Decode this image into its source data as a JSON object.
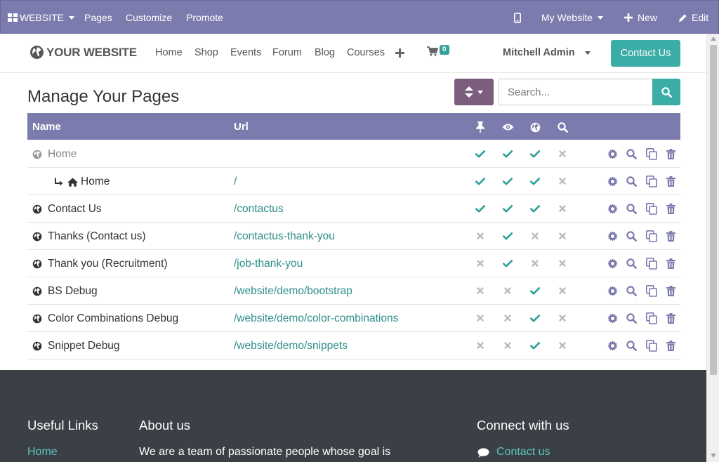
{
  "topbar": {
    "website_label": "WEBSITE",
    "pages_label": "Pages",
    "customize_label": "Customize",
    "promote_label": "Promote",
    "my_website_label": "My Website",
    "new_label": "New",
    "edit_label": "Edit"
  },
  "header": {
    "logo_text": "YOUR WEBSITE",
    "nav": [
      "Home",
      "Shop",
      "Events",
      "Forum",
      "Blog",
      "Courses"
    ],
    "cart_count": "0",
    "user_name": "Mitchell Admin",
    "contact_button": "Contact Us"
  },
  "main": {
    "title": "Manage Your Pages",
    "search_placeholder": "Search...",
    "columns": {
      "name": "Name",
      "url": "Url"
    },
    "rows": [
      {
        "name": "Home",
        "url": "",
        "dim": true,
        "icon": "globe",
        "indent": false,
        "pinned": true,
        "visible": true,
        "published": true,
        "indexed": false
      },
      {
        "name": "Home",
        "url": "/",
        "dim": false,
        "icon": "home",
        "indent": true,
        "pinned": true,
        "visible": true,
        "published": true,
        "indexed": false
      },
      {
        "name": "Contact Us",
        "url": "/contactus",
        "dim": false,
        "icon": "globe",
        "indent": false,
        "pinned": true,
        "visible": true,
        "published": true,
        "indexed": false
      },
      {
        "name": "Thanks (Contact us)",
        "url": "/contactus-thank-you",
        "dim": false,
        "icon": "globe",
        "indent": false,
        "pinned": false,
        "visible": true,
        "published": false,
        "indexed": false
      },
      {
        "name": "Thank you (Recruitment)",
        "url": "/job-thank-you",
        "dim": false,
        "icon": "globe",
        "indent": false,
        "pinned": false,
        "visible": true,
        "published": false,
        "indexed": false
      },
      {
        "name": "BS Debug",
        "url": "/website/demo/bootstrap",
        "dim": false,
        "icon": "globe",
        "indent": false,
        "pinned": false,
        "visible": false,
        "published": true,
        "indexed": false
      },
      {
        "name": "Color Combinations Debug",
        "url": "/website/demo/color-combinations",
        "dim": false,
        "icon": "globe",
        "indent": false,
        "pinned": false,
        "visible": false,
        "published": true,
        "indexed": false
      },
      {
        "name": "Snippet Debug",
        "url": "/website/demo/snippets",
        "dim": false,
        "icon": "globe",
        "indent": false,
        "pinned": false,
        "visible": false,
        "published": true,
        "indexed": false
      }
    ]
  },
  "footer": {
    "useful_links_title": "Useful Links",
    "about_title": "About us",
    "connect_title": "Connect with us",
    "home_link": "Home",
    "about_text": "We are a team of passionate people whose goal is",
    "contact_link": "Contact us"
  },
  "colors": {
    "admin_bar": "#7c7bad",
    "accent_teal": "#3aada6",
    "check": "#2d9f99",
    "cross": "#bbbbbb",
    "action_icon": "#7c7bad",
    "footer_bg": "#3b3f46"
  },
  "icons": {
    "apps": "grid-icon",
    "mobile": "mobile-icon",
    "plus": "plus-icon",
    "pencil": "pencil-icon",
    "cart": "cart-icon",
    "sort": "sort-icon",
    "search": "search-icon",
    "pin": "pin-icon",
    "eye": "eye-icon",
    "globe": "globe-icon",
    "gear": "gear-icon",
    "copy": "copy-icon",
    "trash": "trash-icon",
    "home": "home-icon",
    "arrow": "level-down-arrow-icon",
    "comment": "comment-icon"
  }
}
